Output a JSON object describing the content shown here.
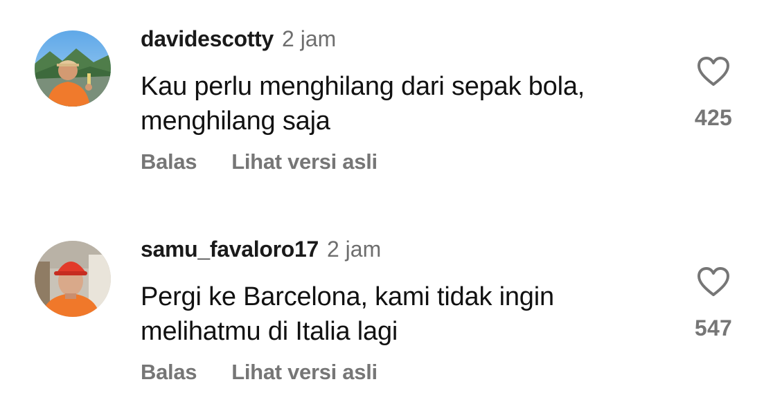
{
  "comments": [
    {
      "username": "davidescotty",
      "time": "2 jam",
      "text": "Kau perlu menghilang dari sepak bola, menghilang saja",
      "likes": "425",
      "reply_label": "Balas",
      "original_label": "Lihat versi asli",
      "heart_icon": "heart-outline-icon"
    },
    {
      "username": "samu_favaloro17",
      "time": "2 jam",
      "text": "Pergi ke Barcelona, kami tidak ingin melihatmu di Italia lagi",
      "likes": "547",
      "reply_label": "Balas",
      "original_label": "Lihat versi asli",
      "heart_icon": "heart-outline-icon"
    }
  ],
  "colors": {
    "username": "#1a1a1a",
    "meta": "#767676",
    "body": "#111111",
    "background": "#ffffff"
  }
}
